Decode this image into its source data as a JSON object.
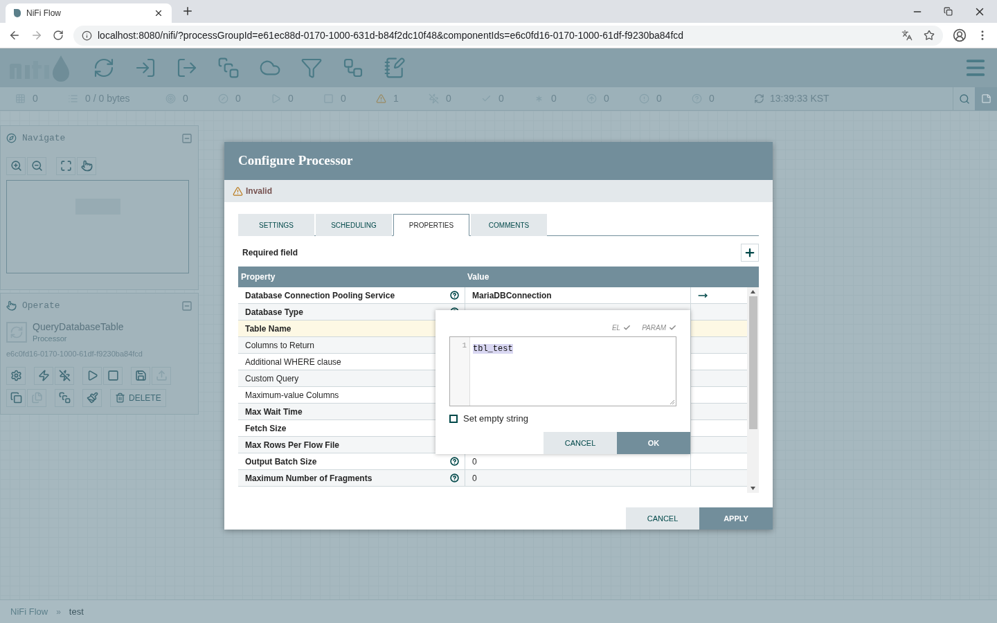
{
  "browser": {
    "tab_title": "NiFi Flow",
    "url": "localhost:8080/nifi/?processGroupId=e61ec88d-0170-1000-631d-b84f2dc10f48&componentIds=e6c0fd16-0170-1000-61df-f9230ba84fcd"
  },
  "status_bar": {
    "items": [
      {
        "kind": "cluster",
        "value": "0"
      },
      {
        "kind": "queued",
        "value": "0 / 0 bytes"
      },
      {
        "kind": "transmitting",
        "value": "0"
      },
      {
        "kind": "not-transmitting",
        "value": "0"
      },
      {
        "kind": "running",
        "value": "0"
      },
      {
        "kind": "stopped",
        "value": "0"
      },
      {
        "kind": "invalid",
        "value": "1"
      },
      {
        "kind": "disabled",
        "value": "0"
      },
      {
        "kind": "up-to-date",
        "value": "0"
      },
      {
        "kind": "modified",
        "value": "0"
      },
      {
        "kind": "stale",
        "value": "0"
      },
      {
        "kind": "errors",
        "value": "0"
      },
      {
        "kind": "unknown",
        "value": "0"
      }
    ],
    "time": "13:39:33 KST"
  },
  "navigate": {
    "title": "Navigate"
  },
  "operate": {
    "title": "Operate",
    "component_name": "QueryDatabaseTable",
    "component_type": "Processor",
    "component_id": "e6c0fd16-0170-1000-61df-f9230ba84fcd",
    "delete_label": "DELETE"
  },
  "dialog": {
    "title": "Configure Processor",
    "status": "Invalid",
    "tabs": [
      {
        "label": "SETTINGS",
        "selected": false
      },
      {
        "label": "SCHEDULING",
        "selected": false
      },
      {
        "label": "PROPERTIES",
        "selected": true
      },
      {
        "label": "COMMENTS",
        "selected": false
      }
    ],
    "required_label": "Required field",
    "columns": [
      "Property",
      "Value"
    ],
    "rows": [
      {
        "name": "Database Connection Pooling Service",
        "value": "MariaDBConnection",
        "required": true,
        "help": true,
        "go_to": true,
        "selected": false
      },
      {
        "name": "Database Type",
        "required": true,
        "help": true,
        "go_to": false,
        "selected": false
      },
      {
        "name": "Table Name",
        "required": true,
        "go_to": false,
        "selected": true
      },
      {
        "name": "Columns to Return",
        "required": false,
        "go_to": false,
        "selected": false
      },
      {
        "name": "Additional WHERE clause",
        "required": false,
        "go_to": false,
        "selected": false
      },
      {
        "name": "Custom Query",
        "required": false,
        "go_to": false,
        "selected": false
      },
      {
        "name": "Maximum-value Columns",
        "required": false,
        "go_to": false,
        "selected": false
      },
      {
        "name": "Max Wait Time",
        "required": true,
        "go_to": false,
        "selected": false
      },
      {
        "name": "Fetch Size",
        "required": true,
        "go_to": false,
        "selected": false
      },
      {
        "name": "Max Rows Per Flow File",
        "required": true,
        "go_to": false,
        "selected": false
      },
      {
        "name": "Output Batch Size",
        "value": "0",
        "required": true,
        "help": true,
        "go_to": false,
        "selected": false
      },
      {
        "name": "Maximum Number of Fragments",
        "value": "0",
        "required": true,
        "help": true,
        "go_to": false,
        "selected": false
      }
    ],
    "editor": {
      "flags": [
        {
          "label": "EL",
          "supported": true
        },
        {
          "label": "PARAM",
          "supported": true
        }
      ],
      "line_number": "1",
      "value": "tbl_test",
      "set_empty_label": "Set empty string",
      "set_empty_checked": false,
      "cancel": "CANCEL",
      "ok": "OK"
    },
    "buttons": {
      "cancel": "CANCEL",
      "apply": "APPLY"
    }
  },
  "breadcrumb": {
    "items": [
      "NiFi Flow",
      "test"
    ],
    "separator": "»"
  }
}
